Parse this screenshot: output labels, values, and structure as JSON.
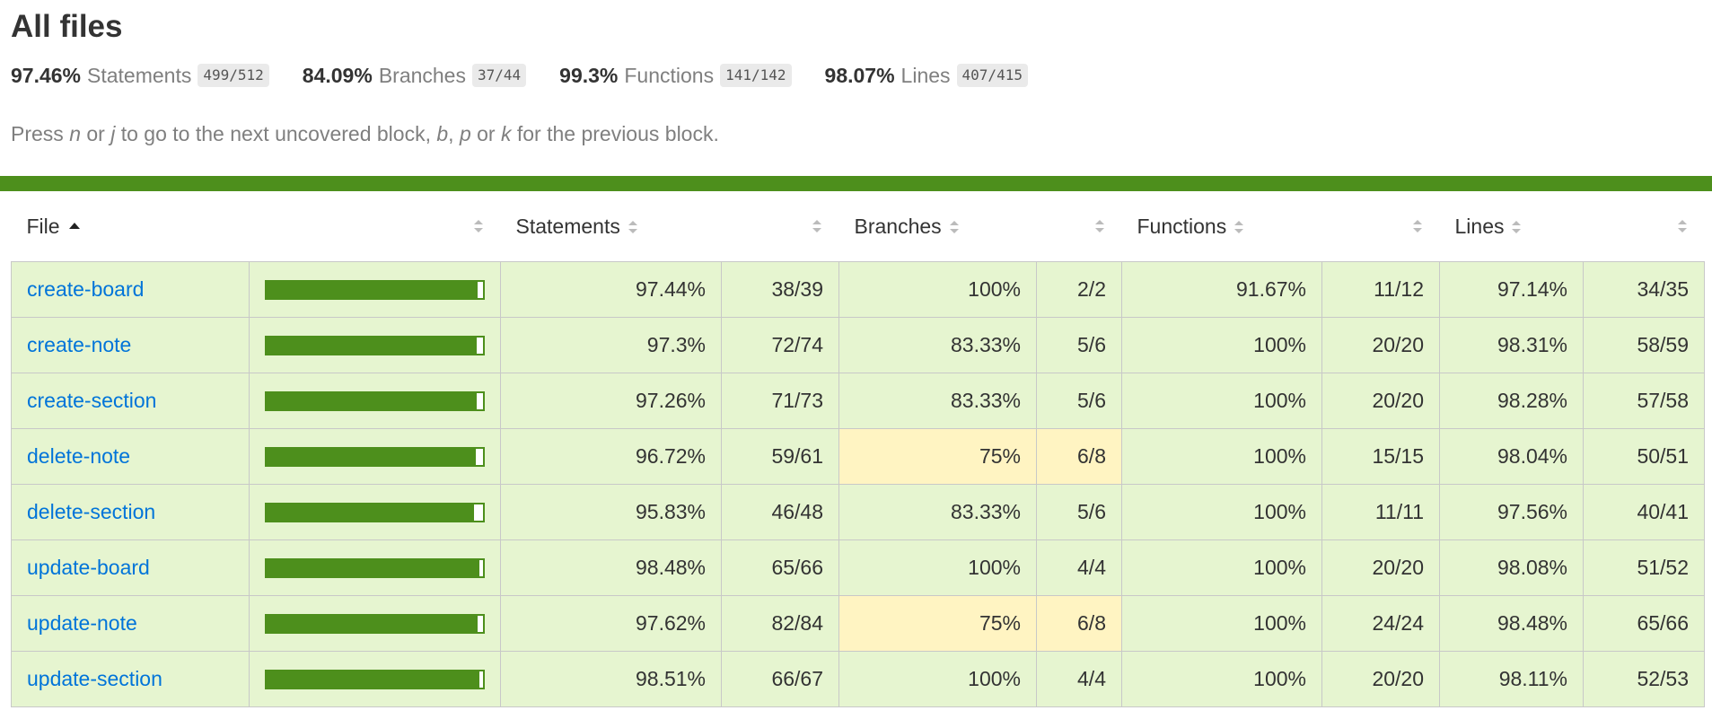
{
  "title": "All files",
  "summary": [
    {
      "pct": "97.46%",
      "label": "Statements",
      "frac": "499/512"
    },
    {
      "pct": "84.09%",
      "label": "Branches",
      "frac": "37/44"
    },
    {
      "pct": "99.3%",
      "label": "Functions",
      "frac": "141/142"
    },
    {
      "pct": "98.07%",
      "label": "Lines",
      "frac": "407/415"
    }
  ],
  "hint": {
    "p1": "Press ",
    "k1": "n",
    "p2": " or ",
    "k2": "j",
    "p3": " to go to the next uncovered block, ",
    "k3": "b",
    "p4": ", ",
    "k4": "p",
    "p5": " or ",
    "k5": "k",
    "p6": " for the previous block."
  },
  "colors": {
    "high": "#e6f5d0",
    "medium": "#fff4c2",
    "bar": "#4d8f1c",
    "link": "#0074d9"
  },
  "headers": {
    "file": "File",
    "statements": "Statements",
    "branches": "Branches",
    "functions": "Functions",
    "lines": "Lines"
  },
  "rows": [
    {
      "file": "create-board",
      "bar": 0.9744,
      "stmt_pct": "97.44%",
      "stmt": "38/39",
      "br_pct": "100%",
      "br": "2/2",
      "br_level": "high",
      "fn_pct": "91.67%",
      "fn": "11/12",
      "ln_pct": "97.14%",
      "ln": "34/35"
    },
    {
      "file": "create-note",
      "bar": 0.973,
      "stmt_pct": "97.3%",
      "stmt": "72/74",
      "br_pct": "83.33%",
      "br": "5/6",
      "br_level": "high",
      "fn_pct": "100%",
      "fn": "20/20",
      "ln_pct": "98.31%",
      "ln": "58/59"
    },
    {
      "file": "create-section",
      "bar": 0.9726,
      "stmt_pct": "97.26%",
      "stmt": "71/73",
      "br_pct": "83.33%",
      "br": "5/6",
      "br_level": "high",
      "fn_pct": "100%",
      "fn": "20/20",
      "ln_pct": "98.28%",
      "ln": "57/58"
    },
    {
      "file": "delete-note",
      "bar": 0.9672,
      "stmt_pct": "96.72%",
      "stmt": "59/61",
      "br_pct": "75%",
      "br": "6/8",
      "br_level": "medium",
      "fn_pct": "100%",
      "fn": "15/15",
      "ln_pct": "98.04%",
      "ln": "50/51"
    },
    {
      "file": "delete-section",
      "bar": 0.9583,
      "stmt_pct": "95.83%",
      "stmt": "46/48",
      "br_pct": "83.33%",
      "br": "5/6",
      "br_level": "high",
      "fn_pct": "100%",
      "fn": "11/11",
      "ln_pct": "97.56%",
      "ln": "40/41"
    },
    {
      "file": "update-board",
      "bar": 0.9848,
      "stmt_pct": "98.48%",
      "stmt": "65/66",
      "br_pct": "100%",
      "br": "4/4",
      "br_level": "high",
      "fn_pct": "100%",
      "fn": "20/20",
      "ln_pct": "98.08%",
      "ln": "51/52"
    },
    {
      "file": "update-note",
      "bar": 0.9762,
      "stmt_pct": "97.62%",
      "stmt": "82/84",
      "br_pct": "75%",
      "br": "6/8",
      "br_level": "medium",
      "fn_pct": "100%",
      "fn": "24/24",
      "ln_pct": "98.48%",
      "ln": "65/66"
    },
    {
      "file": "update-section",
      "bar": 0.9851,
      "stmt_pct": "98.51%",
      "stmt": "66/67",
      "br_pct": "100%",
      "br": "4/4",
      "br_level": "high",
      "fn_pct": "100%",
      "fn": "20/20",
      "ln_pct": "98.11%",
      "ln": "52/53"
    }
  ]
}
